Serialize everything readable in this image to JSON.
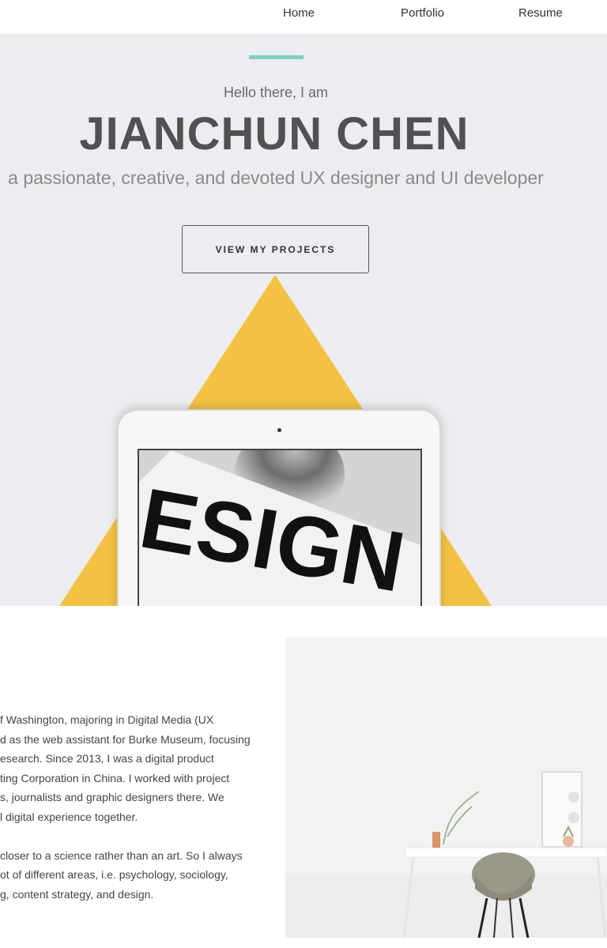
{
  "nav": {
    "items": [
      {
        "label": "Home"
      },
      {
        "label": "Portfolio"
      },
      {
        "label": "Resume"
      }
    ]
  },
  "hero": {
    "greeting": "Hello there, I am",
    "name": "JIANCHUN CHEN",
    "tagline": "a passionate, creative, and devoted UX designer and UI developer",
    "cta_label": "VIEW MY PROJECTS",
    "screen_text": "ESIGN",
    "colors": {
      "background": "#ecedf0",
      "accent": "#7fcfc9",
      "triangle": "#f4c242"
    }
  },
  "about": {
    "lines": [
      "f Washington, majoring in Digital Media (UX",
      "d as the web assistant for Burke Museum, focusing",
      "esearch. Since 2013, I was a digital product",
      "ting Corporation in China. I worked with project",
      "s, journalists and graphic designers there. We",
      "l digital experience together.",
      "",
      "closer to a science rather than an art. So I always",
      "ot of different areas, i.e. psychology, sociology,",
      "g, content strategy, and design."
    ]
  }
}
